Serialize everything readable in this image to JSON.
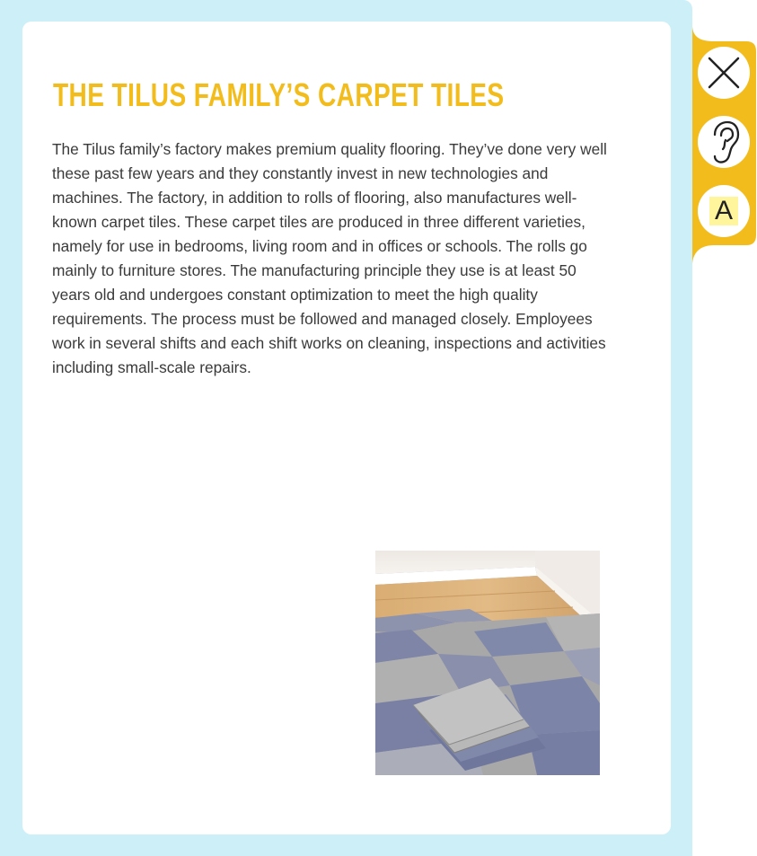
{
  "article": {
    "title": "THE TILUS FAMILY’S CARPET TILES",
    "body": "The Tilus family’s factory makes premium quality flooring. They’ve done very well these past few years and they constantly invest in new technologies and machines. The factory, in addition to rolls of flooring, also manufactures well-known carpet tiles. These carpet tiles are produced in three different varieties, namely for use in bedrooms, living room and in offices or schools. The rolls go mainly to furniture stores. The manufacturing principle they use is at least 50 years old and undergoes constant optimization to meet the high quality requirements. The process must be followed and managed closely. Employees work in several shifts and each shift works on cleaning, inspections and activities including small-scale repairs."
  },
  "toolbar": {
    "close_icon": "close-icon",
    "listen_icon": "ear-icon",
    "font_icon": "font-size-icon",
    "font_label": "A"
  },
  "colors": {
    "frame": "#cdeff8",
    "accent": "#f2bd1c",
    "title": "#f2bd1c",
    "text": "#3a3a3a",
    "highlight": "#fff59d"
  }
}
